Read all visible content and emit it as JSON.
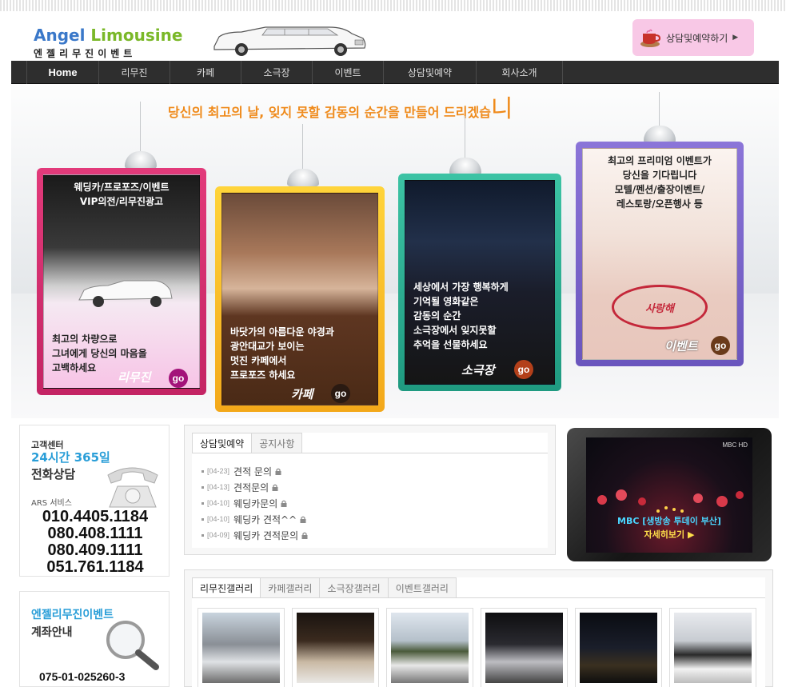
{
  "header": {
    "logo_en_1": "Angel",
    "logo_en_2": "Limousine",
    "logo_ko": "엔젤리무진이벤트",
    "reserve_button": "상담및예약하기",
    "reserve_arrow": "▶"
  },
  "nav": {
    "items": [
      "Home",
      "리무진",
      "카페",
      "소극장",
      "이벤트",
      "상담및예약",
      "회사소개"
    ]
  },
  "banner": {
    "headline": "당신의 최고의 날, 잊지 못할 감동의 순간을 만들어 드리겠습",
    "headline_cursor": "니",
    "frames": [
      {
        "top_lines": [
          "웨딩카/프로포즈/이벤트",
          "VIP의전/리무진광고"
        ],
        "bottom_lines": [
          "최고의 차량으로",
          "그녀에게 당신의 마음을",
          "고백하세요"
        ],
        "sign": "리무진",
        "go": "go"
      },
      {
        "bottom_lines": [
          "바닷가의 아름다운 야경과",
          "광안대교가 보이는",
          "멋진 카페에서",
          "프로포즈 하세요"
        ],
        "sign": "카페",
        "go": "go"
      },
      {
        "bottom_lines": [
          "세상에서 가장 행복하게",
          "기억될 영화같은",
          "감동의 순간",
          "소극장에서 잊지못할",
          "추억을 선물하세요"
        ],
        "sign": "소극장",
        "go": "go"
      },
      {
        "top_lines": [
          "최고의 프리미엄 이벤트가",
          "당신을 기다립니다",
          "모텔/펜션/출장이벤트/",
          "레스토랑/오픈행사 등"
        ],
        "sign": "이벤트",
        "go": "go",
        "floor_text": "사랑해"
      }
    ]
  },
  "customer_center": {
    "title": "고객센터",
    "hours": "24시간 365일",
    "label": "전화상담",
    "ars": "ARS 서비스",
    "numbers": [
      "010.4405.1184",
      "080.408.1111",
      "080.409.1111",
      "051.761.1184"
    ]
  },
  "account": {
    "title": "엔젤리무진이벤트",
    "subtitle": "계좌안내",
    "number": "075-01-025260-3"
  },
  "board": {
    "tabs": [
      "상담및예약",
      "공지사항"
    ],
    "items": [
      {
        "date": "[04-23]",
        "title": "견적 문의"
      },
      {
        "date": "[04-13]",
        "title": "견적문의"
      },
      {
        "date": "[04-10]",
        "title": "웨딩카문의"
      },
      {
        "date": "[04-10]",
        "title": "웨딩카 견적^^"
      },
      {
        "date": "[04-09]",
        "title": "웨딩카 견적문의"
      }
    ]
  },
  "video": {
    "channel": "MBC HD",
    "caption1": "MBC [생방송 투데이 부산]",
    "caption2": "자세히보기 ▶"
  },
  "gallery": {
    "tabs": [
      "리무진갤러리",
      "카페갤러리",
      "소극장갤러리",
      "이벤트갤러리"
    ]
  },
  "colors": {
    "nav_bg": "#2e2e2e",
    "accent_orange": "#ef8a1a",
    "accent_blue": "#2a9ed8",
    "frame_pink": "#d42c6e",
    "frame_yellow": "#f9c02a",
    "frame_teal": "#2bb293",
    "frame_purple": "#7b65cc"
  }
}
